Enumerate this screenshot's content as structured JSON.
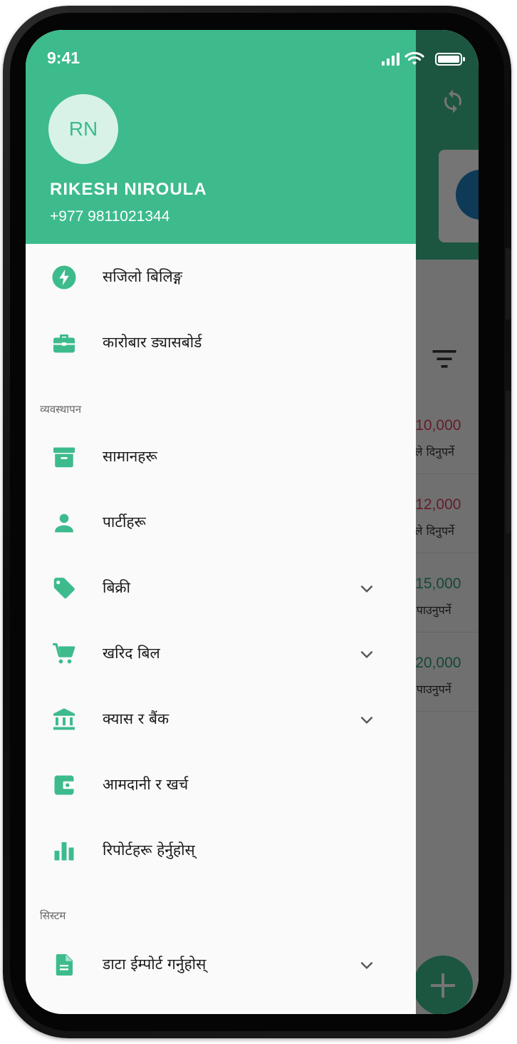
{
  "status_bar": {
    "time": "9:41"
  },
  "user": {
    "initials": "RN",
    "name": "RIKESH NIROULA",
    "phone": "+977 9811021344"
  },
  "colors": {
    "brand": "#3dbb8d",
    "pay": "#d9405a",
    "receive": "#2e9e70"
  },
  "drawer": {
    "top_items": [
      {
        "label": "सजिलो बिलिङ्ग",
        "icon": "flash-icon"
      },
      {
        "label": "कारोबार ड्यासबोर्ड",
        "icon": "briefcase-icon"
      }
    ],
    "management": {
      "title": "व्यवस्थापन",
      "items": [
        {
          "label": "सामानहरू",
          "icon": "archive-box-icon",
          "expandable": false
        },
        {
          "label": "पार्टीहरू",
          "icon": "person-icon",
          "expandable": false
        },
        {
          "label": "बिक्री",
          "icon": "tag-icon",
          "expandable": true
        },
        {
          "label": "खरिद बिल",
          "icon": "cart-icon",
          "expandable": true
        },
        {
          "label": "क्यास र बैंक",
          "icon": "bank-icon",
          "expandable": true
        },
        {
          "label": "आमदानी र खर्च",
          "icon": "wallet-icon",
          "expandable": false
        },
        {
          "label": "रिपोर्टहरू हेर्नुहोस्",
          "icon": "bar-chart-icon",
          "expandable": false
        }
      ]
    },
    "system": {
      "title": "सिस्टम",
      "items": [
        {
          "label": "डाटा ईम्पोर्ट गर्नुहोस्",
          "icon": "document-icon",
          "expandable": true
        }
      ]
    }
  },
  "background_list": [
    {
      "amount": "₹ 10,000",
      "note": "ाईंले दिनुपर्ने"
    },
    {
      "amount": "₹ 12,000",
      "note": "ाईंले दिनुपर्ने"
    },
    {
      "amount": "₹ 15,000",
      "note": "ईले पाउनुपर्ने"
    },
    {
      "amount": "₹ 20,000",
      "note": "ईले पाउनुपर्ने"
    }
  ]
}
